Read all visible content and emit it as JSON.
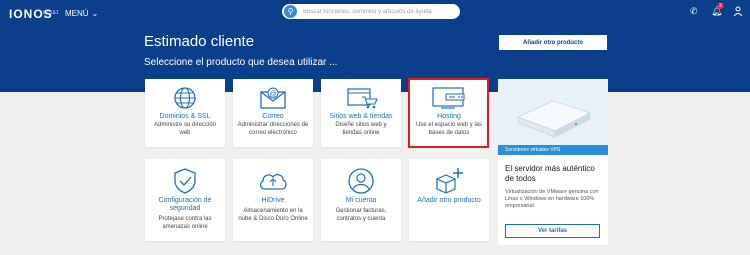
{
  "header": {
    "logo": "IONOS",
    "logo_sub": "by 1&1",
    "menu_label": "MENÚ",
    "search_placeholder": "Buscar funciones, dominios y artículos de ayuda",
    "notification_count": "3"
  },
  "hero": {
    "title": "Estimado cliente",
    "subtitle": "Seleccione el producto que desea utilizar ...",
    "add_button": "Añadir otro producto"
  },
  "products_row1": [
    {
      "title": "Dominios & SSL",
      "desc": "Administre su dirección web",
      "icon": "globe-icon"
    },
    {
      "title": "Correo",
      "desc": "Administrar direcciones de correo electrónico",
      "icon": "envelope-icon"
    },
    {
      "title": "Sitios web & tiendas",
      "desc": "Diseñe sitios web y tiendas online",
      "icon": "cart-icon"
    },
    {
      "title": "Hosting",
      "desc": "Use el espacio web y las bases de datos",
      "icon": "server-icon"
    }
  ],
  "products_row2": [
    {
      "title": "Configuración de seguridad",
      "desc": "Protejase contra las amenazas online",
      "icon": "shield-icon"
    },
    {
      "title": "HiDrive",
      "desc": "Almacenamiento en la nube & Disco Duro Online",
      "icon": "cloud-icon"
    },
    {
      "title": "Mi cuenta",
      "desc": "Gestionar facturas, contratos y cuenta",
      "icon": "user-icon"
    },
    {
      "title": "Añadir otro producto",
      "desc": "",
      "icon": "add-box-icon"
    }
  ],
  "promo": {
    "tag": "Servidores virtuales VPS",
    "title": "El servidor más auténtico de todos",
    "desc": "Virtualización de VMware genuina con Linux o Windows en hardware 100% empresarial.",
    "button": "Ver tarifas"
  },
  "colors": {
    "hero_bg": "#0b3f8c",
    "accent": "#1f6fc0",
    "highlight": "#e01b24"
  }
}
